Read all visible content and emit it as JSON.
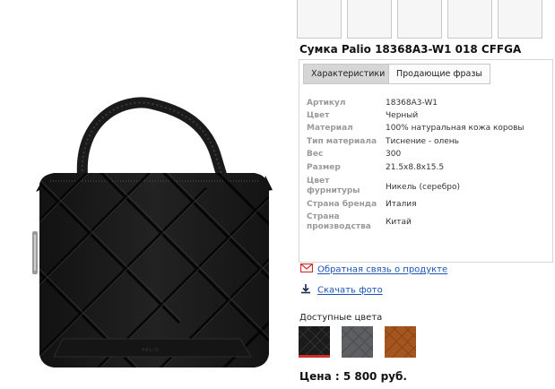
{
  "product": {
    "title": "Сумка Palio 18368A3-W1 018 CFFGA",
    "image": "black-quilted-leather-bag",
    "brand_stamp": "PALIO"
  },
  "tabs": [
    {
      "label": "Характеристики",
      "active": true
    },
    {
      "label": "Продающие фразы",
      "active": false
    }
  ],
  "specs": [
    {
      "key": "Артикул",
      "value": "18368A3-W1"
    },
    {
      "key": "Цвет",
      "value": "Черный"
    },
    {
      "key": "Материал",
      "value": "100% натуральная кожа коровы"
    },
    {
      "key": "Тип материала",
      "value": "Тиснение - олень"
    },
    {
      "key": "Вес",
      "value": "300"
    },
    {
      "key": "Размер",
      "value": "21.5x8.8x15.5"
    },
    {
      "key": "Цвет фурнитуры",
      "value": "Никель (серебро)"
    },
    {
      "key": "Страна бренда",
      "value": "Италия"
    },
    {
      "key": "Страна производства",
      "value": "Китай"
    }
  ],
  "links": {
    "feedback": "Обратная связь о продукте",
    "download": "Скачать фото"
  },
  "colors": {
    "label": "Доступные цвета",
    "swatches": [
      {
        "name": "black",
        "hex": "#1b1b1b",
        "selected": true
      },
      {
        "name": "grey",
        "hex": "#5d5f62",
        "selected": false
      },
      {
        "name": "brown",
        "hex": "#a5561f",
        "selected": false
      }
    ]
  },
  "price": "Цена : 5 800 руб.",
  "accent": {
    "link": "#1a53b5",
    "mail_icon": "#d22b2b",
    "selected_swatch": "#d22b2b"
  }
}
